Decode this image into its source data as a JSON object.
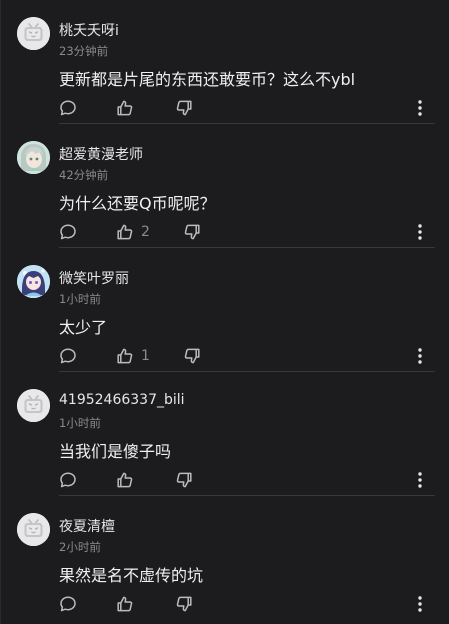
{
  "comments": [
    {
      "username": "桃夭夭呀i",
      "time": "23分钟前",
      "content": "更新都是片尾的东西还敢要币？这么不ybl",
      "likes": ""
    },
    {
      "username": "超爱黄漫老师",
      "time": "42分钟前",
      "content": "为什么还要Q币呢呢？",
      "likes": "2"
    },
    {
      "username": "微笑叶罗丽",
      "time": "1小时前",
      "content": "太少了",
      "likes": "1"
    },
    {
      "username": "41952466337_bili",
      "time": "1小时前",
      "content": "当我们是傻子吗",
      "likes": ""
    },
    {
      "username": "夜夏清檀",
      "time": "2小时前",
      "content": "果然是名不虚传的坑",
      "likes": ""
    }
  ],
  "icons": {
    "reply": "reply-icon",
    "like": "thumbs-up-icon",
    "dislike": "thumbs-down-icon",
    "more": "more-vertical-icon",
    "default_avatar": "bilibili-tv-avatar"
  },
  "colors": {
    "background": "#1c1c1e",
    "text_primary": "#f0f0f2",
    "text_secondary": "#8a8a8f",
    "divider": "#38383b"
  }
}
